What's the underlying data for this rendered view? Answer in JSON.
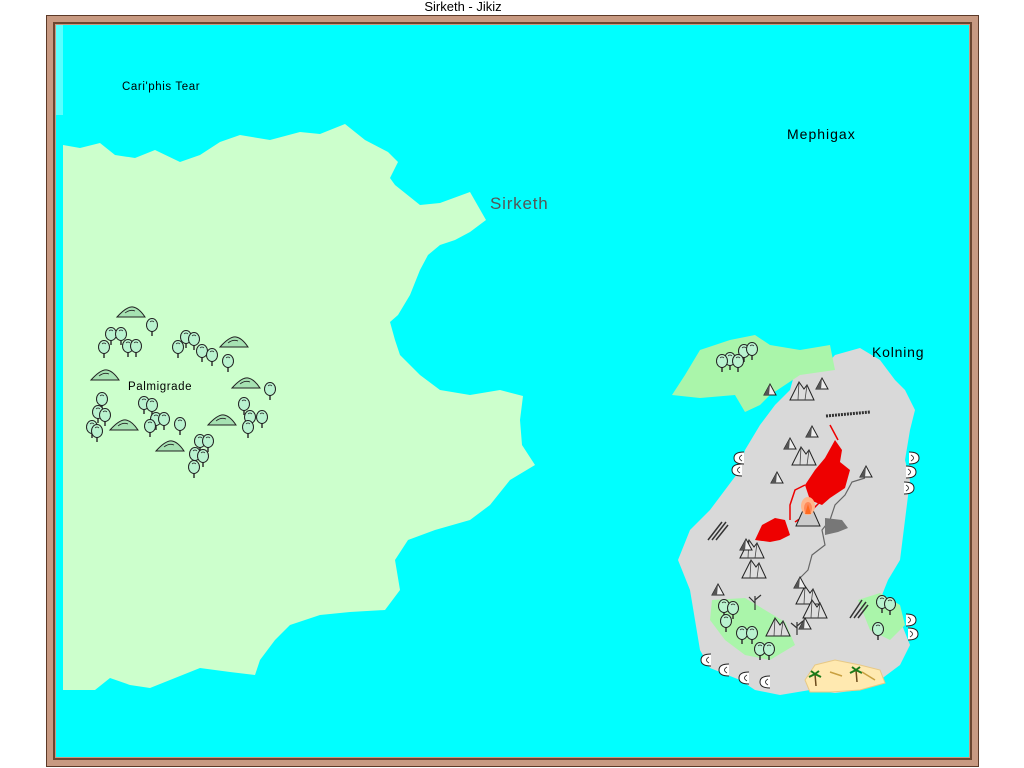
{
  "window": {
    "title": "Sirketh - Jikiz"
  },
  "map": {
    "labels": {
      "cariphis_tear": "Cari'phis Tear",
      "mephigax": "Mephigax",
      "sirketh": "Sirketh",
      "kolning": "Kolning",
      "palmigrade": "Palmigrade"
    },
    "colors": {
      "sea": "#00ffff",
      "grassland": "#ccffcc",
      "forest_land": "#aaf5aa",
      "mountain_land": "#d9d9d9",
      "lava": "#ee0000",
      "beach": "#ffe9b0",
      "frame": "#c89a82"
    },
    "icons": [
      "tree-icon",
      "hill-icon",
      "mountain-icon",
      "volcano-icon",
      "palm-tree-icon",
      "surf-icon"
    ]
  }
}
